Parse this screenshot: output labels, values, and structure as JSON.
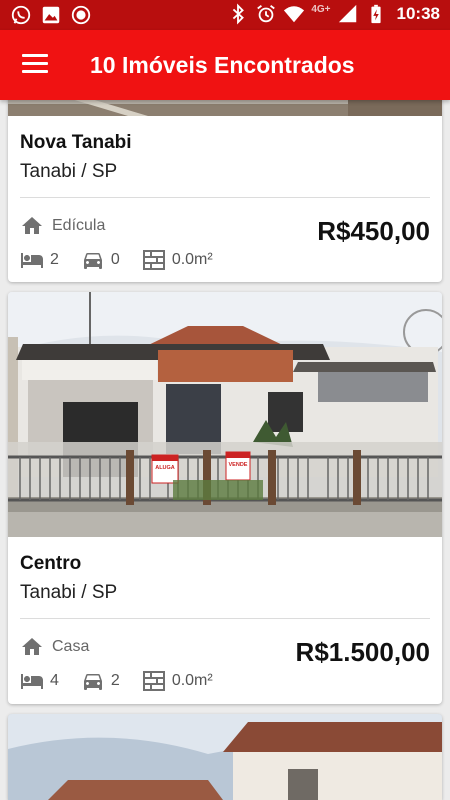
{
  "statusbar": {
    "time": "10:38",
    "network": "4G+"
  },
  "appbar": {
    "title": "10 Imóveis Encontrados"
  },
  "listings": [
    {
      "title": "Nova Tanabi",
      "city": "Tanabi / SP",
      "type": "Edícula",
      "price": "R$450,00",
      "bedrooms": "2",
      "garages": "0",
      "area": "0.0m²"
    },
    {
      "title": "Centro",
      "city": "Tanabi / SP",
      "type": "Casa",
      "price": "R$1.500,00",
      "bedrooms": "4",
      "garages": "2",
      "area": "0.0m²"
    }
  ],
  "signs": {
    "left": "ALUGA",
    "right": "VENDE"
  },
  "colors": {
    "statusbar": "#b80e0e",
    "appbar": "#f01212",
    "background": "#ececec"
  }
}
